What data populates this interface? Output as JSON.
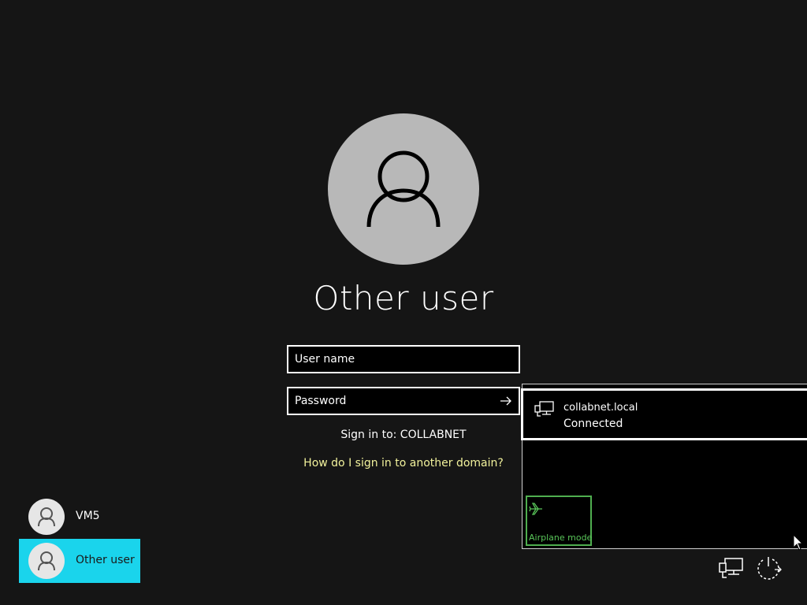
{
  "login": {
    "title": "Other user",
    "username_placeholder": "User name",
    "password_placeholder": "Password",
    "sign_in_to": "Sign in to: COLLABNET",
    "domain_help_link": "How do I sign in to another domain?"
  },
  "users": [
    {
      "label": "VM5",
      "selected": false
    },
    {
      "label": "Other user",
      "selected": true
    }
  ],
  "network_flyout": {
    "network": {
      "name": "collabnet.local",
      "status": "Connected",
      "icon": "wired-network-icon"
    },
    "airplane_mode": {
      "label": "Airplane mode",
      "icon": "airplane-icon"
    }
  },
  "system_buttons": {
    "network_icon": "network-icon",
    "power_icon": "power-icon"
  },
  "colors": {
    "background": "#151515",
    "selected_tile": "#1ad4ec",
    "link": "#f2f29c",
    "airplane_accent": "#4fae4f",
    "avatar": "#b8b8b8"
  }
}
